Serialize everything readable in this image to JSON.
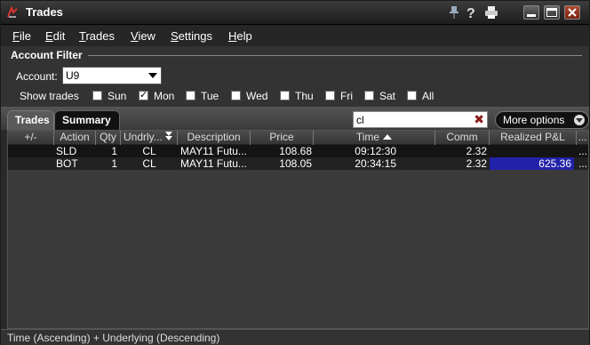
{
  "window": {
    "title": "Trades"
  },
  "menu": [
    {
      "u": "F",
      "rest": "ile"
    },
    {
      "u": "E",
      "rest": "dit"
    },
    {
      "u": "T",
      "rest": "rades"
    },
    {
      "u": "V",
      "rest": "iew"
    },
    {
      "u": "S",
      "rest": "ettings"
    },
    {
      "u": "H",
      "rest": "elp"
    }
  ],
  "filter": {
    "title": "Account Filter",
    "account_label": "Account:",
    "account_value": "U9",
    "show_trades_label": "Show trades",
    "days": [
      {
        "label": "Sun",
        "checked": false
      },
      {
        "label": "Mon",
        "checked": true
      },
      {
        "label": "Tue",
        "checked": false
      },
      {
        "label": "Wed",
        "checked": false
      },
      {
        "label": "Thu",
        "checked": false
      },
      {
        "label": "Fri",
        "checked": false
      },
      {
        "label": "Sat",
        "checked": false
      },
      {
        "label": "All",
        "checked": false
      }
    ]
  },
  "tabs": {
    "trades": "Trades",
    "summary": "Summary"
  },
  "search": {
    "value": "cl",
    "clear": "✖"
  },
  "more_options": "More options",
  "columns": {
    "expand": "+/-",
    "action": "Action",
    "qty": "Qty",
    "underlying": "Undrly...",
    "description": "Description",
    "price": "Price",
    "time": "Time",
    "comm": "Comm",
    "pnl": "Realized P&L",
    "more": "..."
  },
  "rows": [
    {
      "action": "SLD",
      "qty": "1",
      "underlying": "CL",
      "description": "MAY11 Futu...",
      "price": "108.68",
      "time": "09:12:30",
      "comm": "2.32",
      "pnl": "",
      "more": "..."
    },
    {
      "action": "BOT",
      "qty": "1",
      "underlying": "CL",
      "description": "MAY11 Futu...",
      "price": "108.05",
      "time": "20:34:15",
      "comm": "2.32",
      "pnl": "625.36",
      "more": "..."
    }
  ],
  "status": "Time (Ascending)  +  Underlying (Descending)",
  "colors": {
    "pnl_highlight": "#2222a8",
    "clear_icon": "#8b1a1a"
  }
}
